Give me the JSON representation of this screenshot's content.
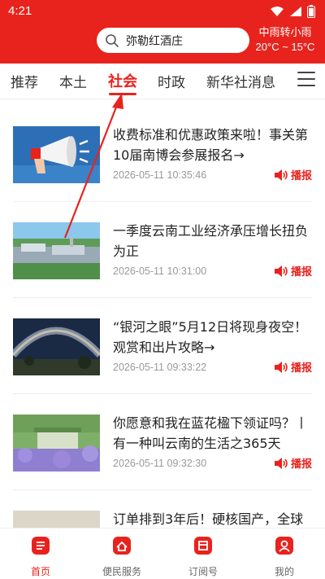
{
  "status_bar": {
    "time": "4:21"
  },
  "search": {
    "text": "弥勒红酒庄"
  },
  "weather": {
    "condition": "中雨转小雨",
    "temperature": "20°C ~ 15°C"
  },
  "tabs": [
    {
      "label": "推荐",
      "active": false
    },
    {
      "label": "本土",
      "active": false
    },
    {
      "label": "社会",
      "active": true
    },
    {
      "label": "时政",
      "active": false
    },
    {
      "label": "新华社消息",
      "active": false
    }
  ],
  "articles": [
    {
      "title": "收费标准和优惠政策来啦！事关第10届南博会参展报名→",
      "time": "2026-05-11 10:35:46",
      "action": "播报"
    },
    {
      "title": "一季度云南工业经济承压增长扭负为正",
      "time": "2026-05-11 10:31:00",
      "action": "播报"
    },
    {
      "title": "“银河之眼”5月12日将现身夜空！观赏和出片攻略→",
      "time": "2026-05-11 09:33:22",
      "action": "播报"
    },
    {
      "title": "你愿意和我在蓝花楹下领证吗？丨有一种叫云南的生活之365天",
      "time": "2026-05-11 09:32:30",
      "action": "播报"
    },
    {
      "title": "订单排到3年后！硬核国产，全球",
      "time": "",
      "action": ""
    }
  ],
  "bottom_nav": [
    {
      "label": "首页",
      "active": true,
      "icon": "home-icon"
    },
    {
      "label": "便民服务",
      "active": false,
      "icon": "service-icon"
    },
    {
      "label": "订阅号",
      "active": false,
      "icon": "subscription-icon"
    },
    {
      "label": "我的",
      "active": false,
      "icon": "profile-icon"
    }
  ],
  "colors": {
    "brand": "#e8231d",
    "text": "#222222",
    "muted": "#999999"
  }
}
